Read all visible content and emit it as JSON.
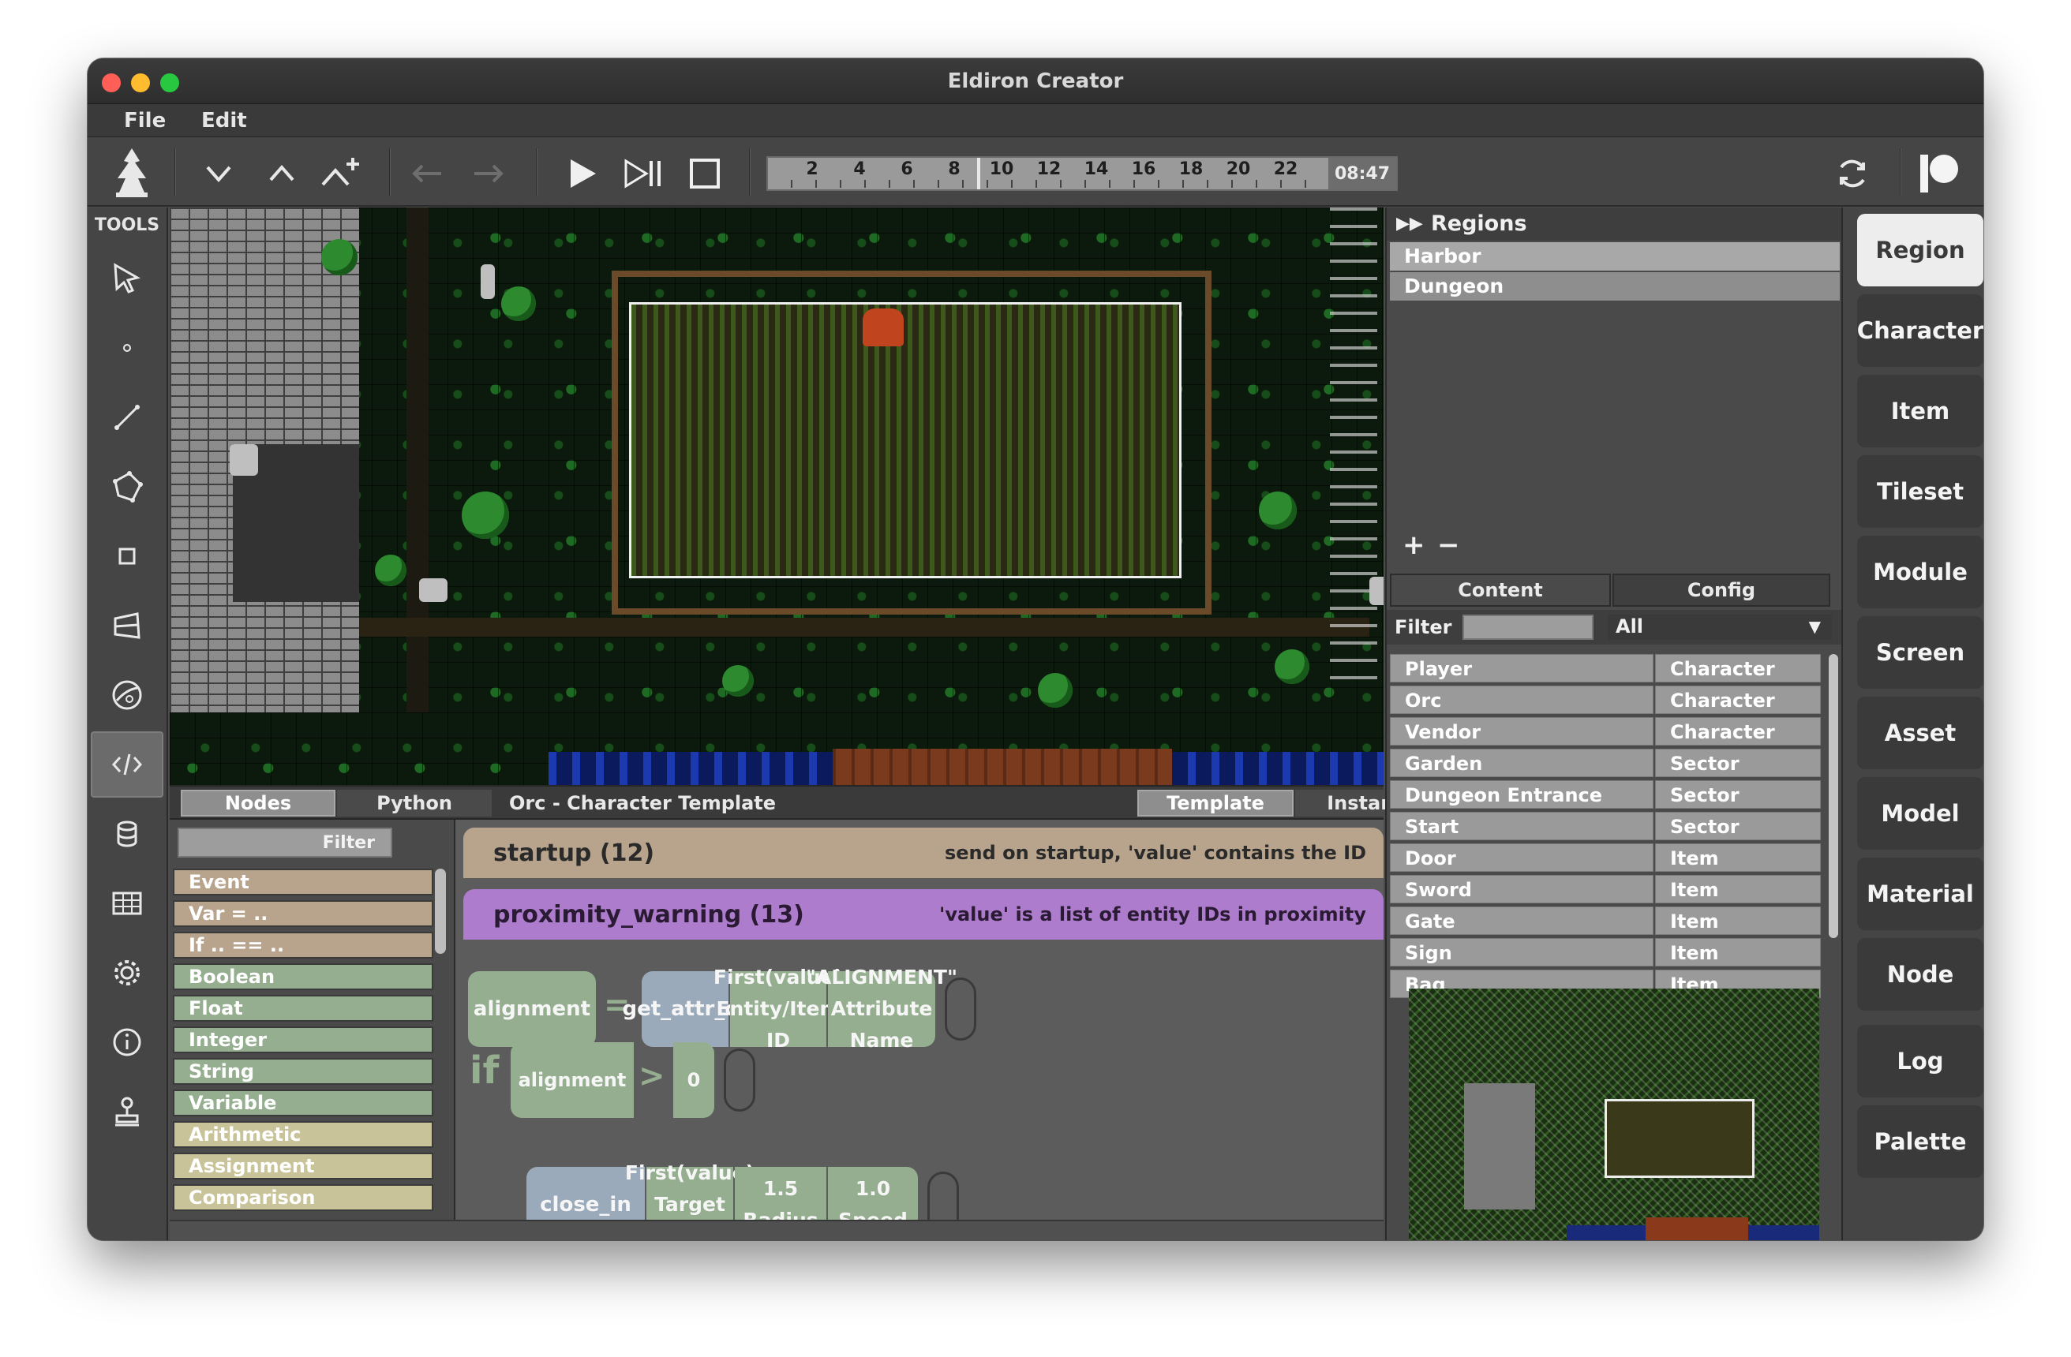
{
  "window": {
    "title": "Eldiron Creator"
  },
  "menu": {
    "file": "File",
    "edit": "Edit"
  },
  "timeline": {
    "ticks": [
      "2",
      "4",
      "6",
      "8",
      "10",
      "12",
      "14",
      "16",
      "18",
      "20",
      "22"
    ],
    "time": "08:47"
  },
  "tools": {
    "label": "TOOLS"
  },
  "editor": {
    "tab_nodes": "Nodes",
    "tab_python": "Python",
    "context": "Orc - Character Template",
    "tab_template": "Template",
    "tab_instance": "Instance"
  },
  "node_panel": {
    "filter": "Filter",
    "items": [
      "Event",
      "Var = ..",
      "If .. == ..",
      "Boolean",
      "Float",
      "Integer",
      "String",
      "Variable",
      "Arithmetic",
      "Assignment",
      "Comparison"
    ]
  },
  "code": {
    "startup_name": "startup (12)",
    "startup_desc": "send on startup, 'value' contains the ID",
    "prox_name": "proximity_warning (13)",
    "prox_desc": "'value' is a list of entity IDs in proximity",
    "var_alignment": "alignment",
    "eq": "=",
    "fn_get_attr": "get_attr_of",
    "arg1_value": "First(value)",
    "arg1_label": "Entity/Item ID",
    "arg2_value": "\"ALIGNMENT\"",
    "arg2_label": "Attribute Name",
    "kw_if": "if",
    "cond_var": "alignment",
    "gt": ">",
    "cond_val": "0",
    "fn_close_in": "close_in",
    "ci_arg1_value": "First(value)",
    "ci_arg1_label": "Target ID",
    "ci_arg2_value": "1.5",
    "ci_arg2_label": "Radius",
    "ci_arg3_value": "1.0",
    "ci_arg3_label": "Speed"
  },
  "regions": {
    "header": "Regions",
    "items": [
      "Harbor",
      "Dungeon"
    ],
    "add": "+",
    "remove": "−",
    "tab_content": "Content",
    "tab_config": "Config",
    "filter_label": "Filter",
    "filter_value": "",
    "filter_select": "All",
    "content": [
      {
        "name": "Player",
        "type": "Character"
      },
      {
        "name": "Orc",
        "type": "Character"
      },
      {
        "name": "Vendor",
        "type": "Character"
      },
      {
        "name": "Garden",
        "type": "Sector"
      },
      {
        "name": "Dungeon Entrance",
        "type": "Sector"
      },
      {
        "name": "Start",
        "type": "Sector"
      },
      {
        "name": "Door",
        "type": "Item"
      },
      {
        "name": "Sword",
        "type": "Item"
      },
      {
        "name": "Gate",
        "type": "Item"
      },
      {
        "name": "Sign",
        "type": "Item"
      },
      {
        "name": "Bag",
        "type": "Item"
      }
    ]
  },
  "nav": [
    "Region",
    "Character",
    "Item",
    "Tileset",
    "Module",
    "Screen",
    "Asset",
    "Model",
    "Material",
    "Node",
    "Log",
    "Palette"
  ],
  "colors": {
    "event": "#b8a48c",
    "value": "#95ae8f",
    "operator": "#c9c399",
    "proximity": "#ad7ccc",
    "function": "#9aaabb"
  }
}
